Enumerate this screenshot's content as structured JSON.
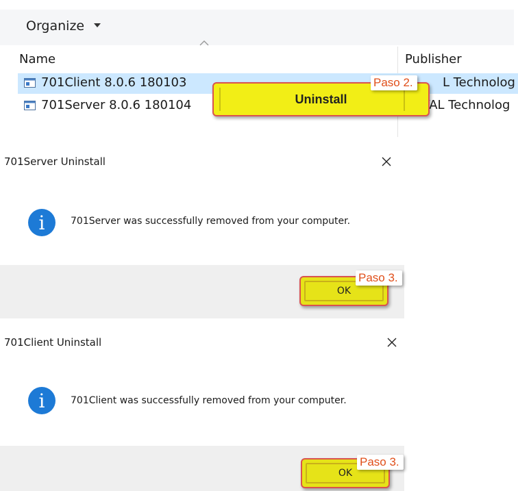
{
  "explorer": {
    "toolbar": {
      "organize_label": "Organize"
    },
    "columns": {
      "name": "Name",
      "publisher": "Publisher"
    },
    "rows": [
      {
        "name": "701Client 8.0.6 180103",
        "publisher": "L Technolog"
      },
      {
        "name": "701Server 8.0.6 180104",
        "publisher": "SOYAL Technolog"
      }
    ],
    "context_action": {
      "label": "Uninstall"
    },
    "step_label": "Paso 2."
  },
  "dialogs": {
    "server": {
      "title": "701Server Uninstall",
      "message": "701Server was successfully removed from your computer.",
      "ok_label": "OK",
      "step_label": "Paso 3."
    },
    "client": {
      "title": "701Client Uninstall",
      "message": "701Client was successfully removed from your computer.",
      "ok_label": "OK",
      "step_label": "Paso 3."
    }
  },
  "colors": {
    "selection": "#cce8ff",
    "highlight": "#f2ee16",
    "annotation_border": "#d9534f",
    "annotation_text": "#e04f1a",
    "info_icon": "#1d7ad6"
  },
  "icons": {
    "organize_caret": "caret-down-icon",
    "sort": "sort-up-icon",
    "app": "application-icon",
    "close": "close-icon",
    "info": "info-icon"
  }
}
